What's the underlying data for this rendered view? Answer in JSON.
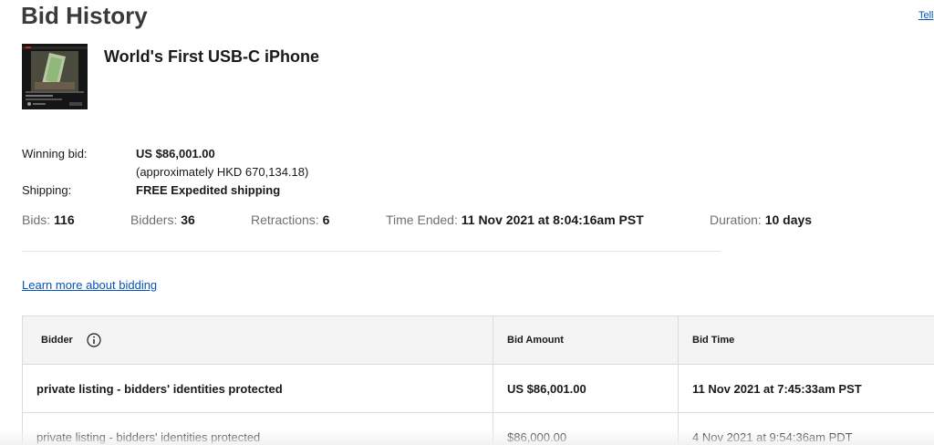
{
  "page": {
    "title": "Bid History",
    "tell_link": "Tell"
  },
  "item": {
    "title": "World's First USB-C iPhone",
    "thumbnail_icon": "video-thumbnail-image"
  },
  "summary": {
    "winning_bid_label": "Winning bid:",
    "winning_bid_value": "US $86,001.00",
    "winning_bid_converted": "(approximately HKD 670,134.18)",
    "shipping_label": "Shipping:",
    "shipping_value": "FREE Expedited shipping"
  },
  "stats": {
    "bids_label": "Bids:",
    "bids_value": "116",
    "bidders_label": "Bidders:",
    "bidders_value": "36",
    "retractions_label": "Retractions:",
    "retractions_value": "6",
    "time_ended_label": "Time Ended:",
    "time_ended_value": "11 Nov 2021 at 8:04:16am PST",
    "duration_label": "Duration:",
    "duration_value": "10 days"
  },
  "learn_more": "Learn more about bidding",
  "table": {
    "headers": {
      "bidder": "Bidder",
      "bid_amount": "Bid Amount",
      "bid_time": "Bid Time"
    },
    "rows": [
      {
        "bidder": "private listing - bidders' identities protected",
        "amount": "US $86,001.00",
        "time": "11 Nov 2021 at 7:45:33am PST",
        "winning": true
      },
      {
        "bidder": "private listing - bidders' identities protected",
        "amount": "$86,000.00",
        "time": "4 Nov 2021 at 9:54:36am PDT",
        "winning": false
      }
    ]
  },
  "colors": {
    "link": "#0654ba",
    "header_bg": "#f4f4f4",
    "border": "#dcdcdc"
  }
}
